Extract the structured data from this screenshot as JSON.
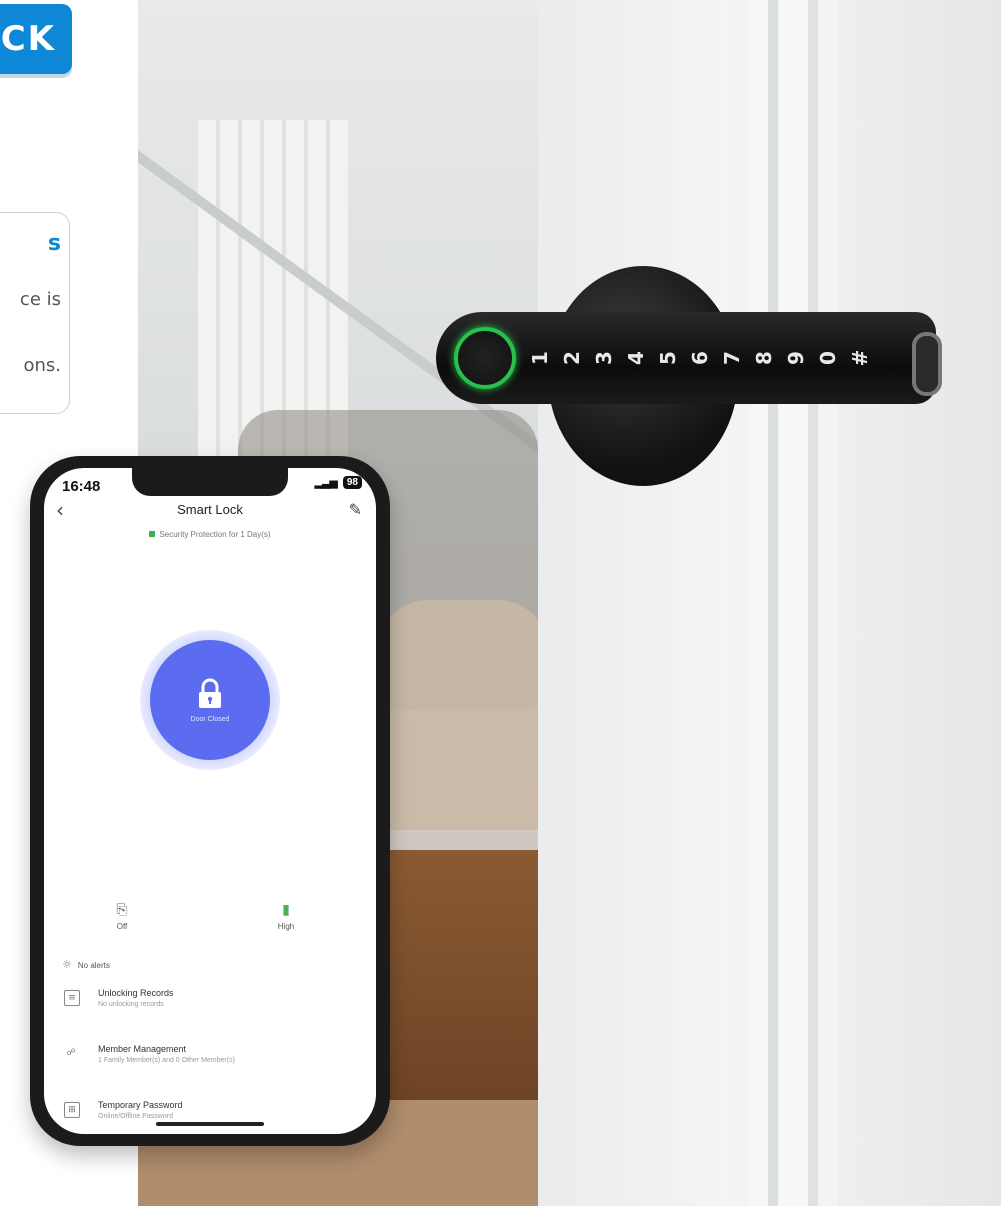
{
  "badge": {
    "text": "CK"
  },
  "feature_card": {
    "title": "s",
    "line1": "ce is",
    "line2": "ons."
  },
  "lock_keypad": {
    "keys": [
      "1",
      "2",
      "3",
      "4",
      "5",
      "6",
      "7",
      "8",
      "9",
      "0",
      "#"
    ]
  },
  "phone": {
    "status_time": "16:48",
    "status_signal": "▂▃▅",
    "battery": "98",
    "app_title": "Smart Lock",
    "security_text": "Security Protection for 1 Day(s)",
    "lock_state": "Door Closed",
    "door_status": "Off",
    "battery_status": "High",
    "alerts": "No alerts",
    "menu": [
      {
        "title": "Unlocking Records",
        "subtitle": "No unlocking records"
      },
      {
        "title": "Member Management",
        "subtitle": "1 Family Member(s) and 0 Other Member(s)"
      },
      {
        "title": "Temporary Password",
        "subtitle": "Online/Offline Password"
      }
    ],
    "accent": "#5b6cf0"
  },
  "colors": {
    "brand_blue": "#0d87d6",
    "fingerprint_ring": "#27c24c"
  }
}
